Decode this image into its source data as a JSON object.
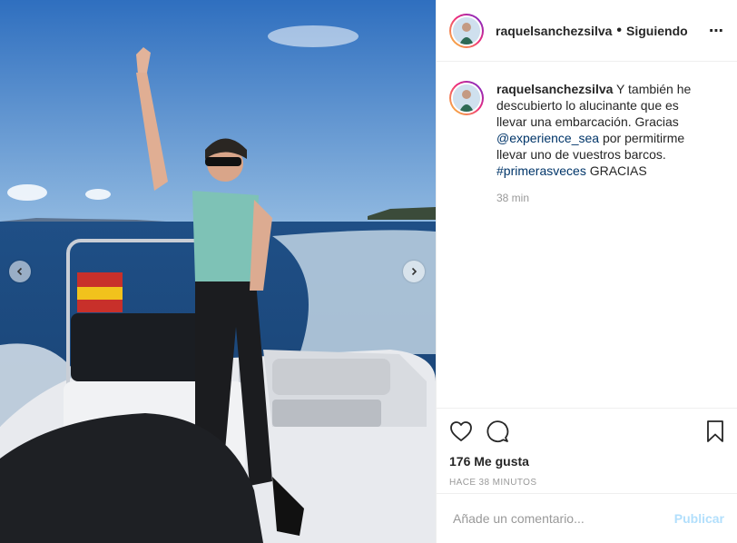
{
  "post": {
    "username": "raquelsanchezsilva",
    "separator": "•",
    "follow_status": "Siguiendo",
    "more_icon": "⋯"
  },
  "caption": {
    "username": "raquelsanchezsilva",
    "text_1": " Y también he descubierto lo alucinante que es llevar una embarcación. Gracias ",
    "mention": "@experience_sea",
    "text_2": " por permitirme llevar uno de vuestros barcos. ",
    "hashtag": "#primerasveces",
    "text_3": " GRACIAS",
    "time": "38 min"
  },
  "stats": {
    "likes": "176 Me gusta",
    "posted": "HACE 38 MINUTOS"
  },
  "comment_box": {
    "placeholder": "Añade un comentario...",
    "publish_label": "Publicar"
  },
  "icons": {
    "like": "heart-icon",
    "comment": "comment-icon",
    "save": "bookmark-icon",
    "prev": "chevron-left-icon",
    "next": "chevron-right-icon"
  },
  "colors": {
    "link": "#003569",
    "muted": "#999999",
    "publish_disabled": "#b2dffc",
    "border": "#efefef"
  }
}
